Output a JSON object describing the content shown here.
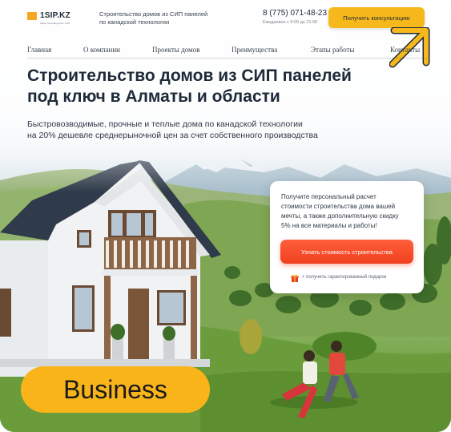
{
  "header": {
    "logo_text": "1SIP.KZ",
    "logo_subtext": "завод-производитель СИП",
    "tagline": "Строительство домов из СИП панелей по канадской технологии",
    "phone": "8 (775) 071-48-23",
    "hours": "Ежедневно с 9:00 до 21:00",
    "consult_button": "Получить консультацию"
  },
  "nav": {
    "items": [
      "Главная",
      "О компании",
      "Проекты домов",
      "Преимущества",
      "Этапы работы",
      "Контакты"
    ]
  },
  "hero": {
    "title_lines": [
      "Строительство домов из СИП панелей",
      "под ключ в Алматы и области"
    ],
    "subtitle_lines": [
      "Быстровозводимые, прочные и теплые дома по канадской технологии",
      "на 20% дешевле среднерыночной цен за счет собственного производства"
    ]
  },
  "offer_card": {
    "text_lines": [
      "Получите персональный расчет",
      "стоимости строительства дома вашей",
      "мечты, а также дополнительную скидку",
      "5% на все материалы и работы!"
    ],
    "button": "Узнать стоимость строительства",
    "gift_text": "+ получить гарантированный подарок"
  },
  "badge": {
    "label": "Business"
  },
  "colors": {
    "accent_yellow": "#f6b81b",
    "cta_red": "#f0401f",
    "text_dark": "#1e2a39"
  }
}
